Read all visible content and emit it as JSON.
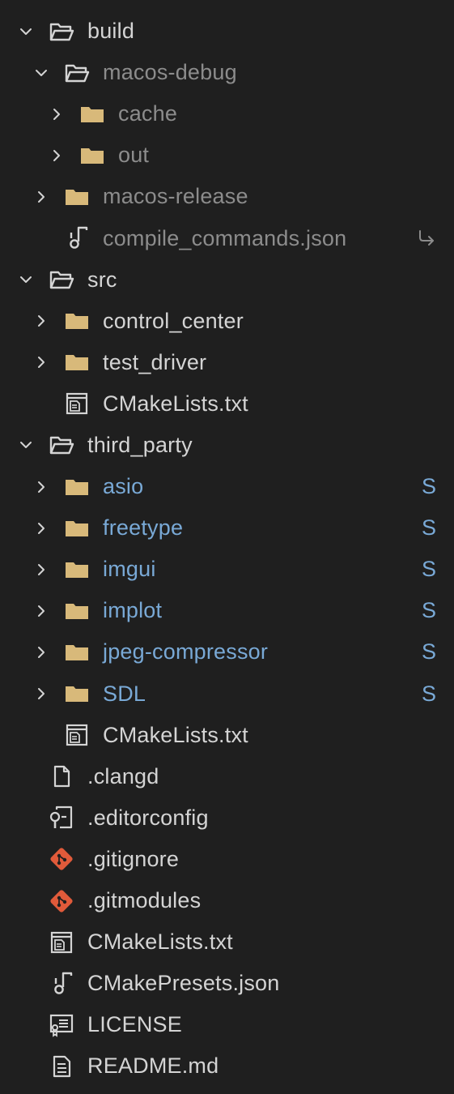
{
  "explorer": {
    "items": [
      {
        "label": "build",
        "kind": "folder-open",
        "depth": 0,
        "chevron": "down",
        "style": "normal"
      },
      {
        "label": "macos-debug",
        "kind": "folder-open",
        "depth": 1,
        "chevron": "down",
        "style": "dim"
      },
      {
        "label": "cache",
        "kind": "folder",
        "depth": 2,
        "chevron": "right",
        "style": "dim"
      },
      {
        "label": "out",
        "kind": "folder",
        "depth": 2,
        "chevron": "right",
        "style": "dim"
      },
      {
        "label": "macos-release",
        "kind": "folder",
        "depth": 1,
        "chevron": "right",
        "style": "dim"
      },
      {
        "label": "compile_commands.json",
        "kind": "json",
        "depth": 1,
        "chevron": "none",
        "style": "dim",
        "symlink": true
      },
      {
        "label": "src",
        "kind": "folder-open",
        "depth": 0,
        "chevron": "down",
        "style": "normal"
      },
      {
        "label": "control_center",
        "kind": "folder",
        "depth": 1,
        "chevron": "right",
        "style": "normal"
      },
      {
        "label": "test_driver",
        "kind": "folder",
        "depth": 1,
        "chevron": "right",
        "style": "normal"
      },
      {
        "label": "CMakeLists.txt",
        "kind": "cmake",
        "depth": 1,
        "chevron": "none",
        "style": "normal"
      },
      {
        "label": "third_party",
        "kind": "folder-open",
        "depth": 0,
        "chevron": "down",
        "style": "normal"
      },
      {
        "label": "asio",
        "kind": "folder",
        "depth": 1,
        "chevron": "right",
        "style": "sub",
        "badge": "S"
      },
      {
        "label": "freetype",
        "kind": "folder",
        "depth": 1,
        "chevron": "right",
        "style": "sub",
        "badge": "S"
      },
      {
        "label": "imgui",
        "kind": "folder",
        "depth": 1,
        "chevron": "right",
        "style": "sub",
        "badge": "S"
      },
      {
        "label": "implot",
        "kind": "folder",
        "depth": 1,
        "chevron": "right",
        "style": "sub",
        "badge": "S"
      },
      {
        "label": "jpeg-compressor",
        "kind": "folder",
        "depth": 1,
        "chevron": "right",
        "style": "sub",
        "badge": "S"
      },
      {
        "label": "SDL",
        "kind": "folder",
        "depth": 1,
        "chevron": "right",
        "style": "sub",
        "badge": "S"
      },
      {
        "label": "CMakeLists.txt",
        "kind": "cmake",
        "depth": 1,
        "chevron": "none",
        "style": "normal"
      },
      {
        "label": ".clangd",
        "kind": "file",
        "depth": 0,
        "chevron": "none",
        "style": "normal"
      },
      {
        "label": ".editorconfig",
        "kind": "editorconfig",
        "depth": 0,
        "chevron": "none",
        "style": "normal"
      },
      {
        "label": ".gitignore",
        "kind": "git",
        "depth": 0,
        "chevron": "none",
        "style": "normal"
      },
      {
        "label": ".gitmodules",
        "kind": "git",
        "depth": 0,
        "chevron": "none",
        "style": "normal"
      },
      {
        "label": "CMakeLists.txt",
        "kind": "cmake",
        "depth": 0,
        "chevron": "none",
        "style": "normal"
      },
      {
        "label": "CMakePresets.json",
        "kind": "json",
        "depth": 0,
        "chevron": "none",
        "style": "normal"
      },
      {
        "label": "LICENSE",
        "kind": "license",
        "depth": 0,
        "chevron": "none",
        "style": "normal"
      },
      {
        "label": "README.md",
        "kind": "markdown",
        "depth": 0,
        "chevron": "none",
        "style": "normal"
      }
    ]
  },
  "colors": {
    "background": "#1f1f1f",
    "text": "#d4d4d4",
    "text_dim": "#8c8c8c",
    "submodule": "#79a9d6",
    "folder": "#d8b97a",
    "git": "#e05a3a"
  },
  "icons": {
    "folder-open": "folder-open-icon",
    "folder": "folder-icon",
    "json": "json-icon",
    "cmake": "cmake-icon",
    "file": "file-icon",
    "editorconfig": "editorconfig-icon",
    "git": "git-icon",
    "license": "license-icon",
    "markdown": "markdown-icon"
  }
}
